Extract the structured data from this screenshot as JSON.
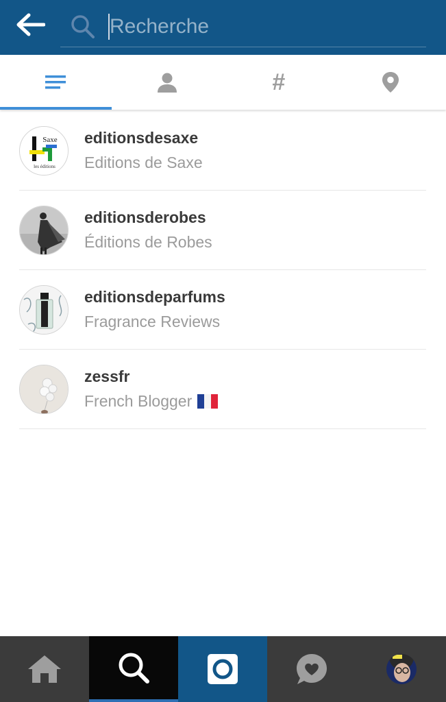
{
  "header": {
    "search_placeholder": "Recherche",
    "search_value": ""
  },
  "tabs": [
    {
      "id": "top",
      "icon": "list-lines-icon",
      "active": true
    },
    {
      "id": "people",
      "icon": "person-icon",
      "active": false
    },
    {
      "id": "tags",
      "icon": "hashtag-icon",
      "glyph": "#",
      "active": false
    },
    {
      "id": "places",
      "icon": "location-pin-icon",
      "active": false
    }
  ],
  "results": [
    {
      "username": "editionsdesaxe",
      "full_name": "Editions de Saxe"
    },
    {
      "username": "editionsderobes",
      "full_name": "Éditions de Robes"
    },
    {
      "username": "editionsdeparfums",
      "full_name": "Fragrance Reviews"
    },
    {
      "username": "zessfr",
      "full_name": "French Blogger",
      "emoji": "french-flag"
    }
  ],
  "bottom_nav": [
    {
      "id": "home",
      "icon": "home-icon",
      "active": false
    },
    {
      "id": "search",
      "icon": "search-icon",
      "active": true
    },
    {
      "id": "camera",
      "icon": "camera-icon",
      "active": false
    },
    {
      "id": "activity",
      "icon": "heart-bubble-icon",
      "active": false
    },
    {
      "id": "profile",
      "icon": "profile-avatar",
      "active": false
    }
  ],
  "colors": {
    "bar_blue": "#125688",
    "tab_accent": "#3f8fd8",
    "bottom_bar": "#3b3b3b",
    "icon_gray": "#9e9e9e",
    "username": "#3a3a3a",
    "full_name": "#9b9b9b"
  }
}
